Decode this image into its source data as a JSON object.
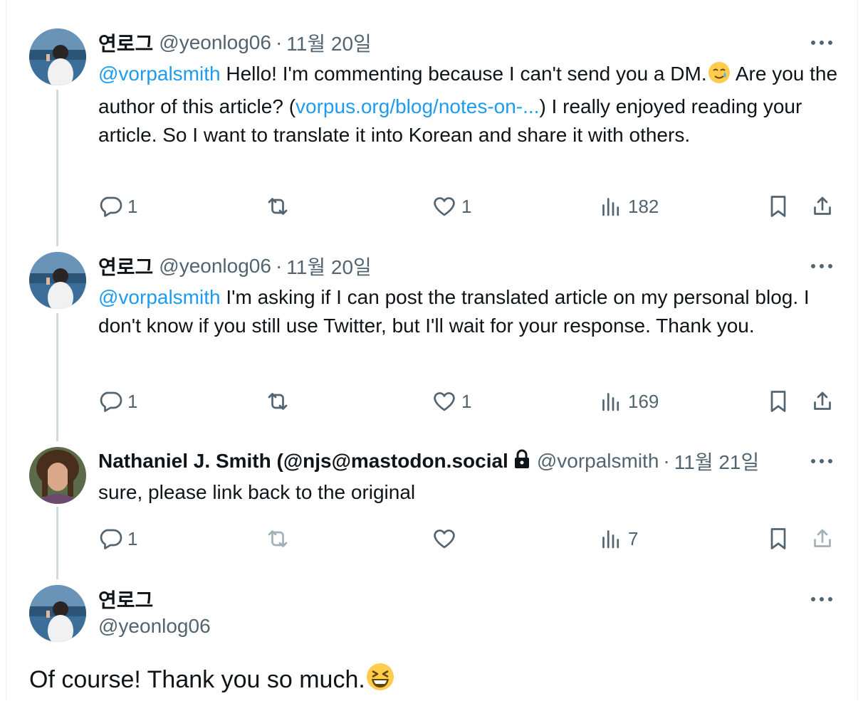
{
  "tweets": [
    {
      "name": "연로그",
      "handle": "@yeonlog06",
      "separator": "·",
      "time": "11월 20일",
      "mention": "@vorpalsmith",
      "text_a": " Hello! I'm commenting because I can't send you a DM.",
      "emoji_a": "smiling-face-with-tear",
      "text_b": " Are you the author of this article? (",
      "link": "vorpus.org/blog/notes-on-...",
      "text_c": ") I really enjoyed reading your article. So I want to translate it into Korean and share it with others.",
      "replies": "1",
      "retweets": "",
      "likes": "1",
      "views": "182"
    },
    {
      "name": "연로그",
      "handle": "@yeonlog06",
      "separator": "·",
      "time": "11월 20일",
      "mention": "@vorpalsmith",
      "text": " I'm asking if I can post the translated article on my personal blog. I don't know if you still use Twitter, but I'll wait for your response. Thank you.",
      "replies": "1",
      "retweets": "",
      "likes": "1",
      "views": "169"
    },
    {
      "name": "Nathaniel J. Smith (@njs@mastodon.social",
      "handle": "@vorpalsmith",
      "separator": "·",
      "time": "11월 21일",
      "text": "sure, please link back to the original",
      "replies": "1",
      "retweets": "",
      "likes": "",
      "views": "7"
    }
  ],
  "main_tweet": {
    "name": "연로그",
    "handle": "@yeonlog06",
    "text": "Of course! Thank you so much.",
    "emoji": "grinning-squinting-face"
  },
  "colors": {
    "text": "#0f1419",
    "secondary": "#536471",
    "link": "#1d9bf0",
    "thread_line": "#cfd9de"
  },
  "icons": {
    "reply": "reply-icon",
    "retweet": "retweet-icon",
    "like": "heart-icon",
    "views": "views-icon",
    "bookmark": "bookmark-icon",
    "share": "share-icon",
    "more": "more-icon",
    "lock": "lock-icon"
  }
}
